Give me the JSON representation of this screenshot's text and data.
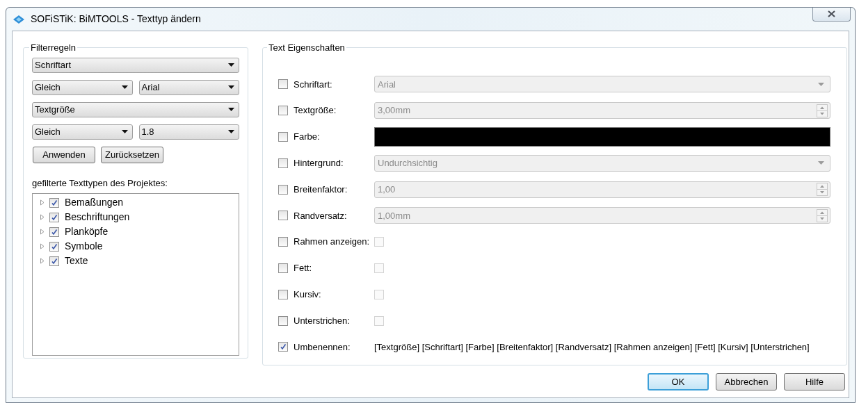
{
  "window": {
    "title": "SOFiSTiK: BiMTOOLS - Texttyp ändern"
  },
  "filter": {
    "title": "Filterregeln",
    "rows": [
      [
        {
          "value": "Schriftart"
        }
      ],
      [
        {
          "value": "Gleich"
        },
        {
          "value": "Arial"
        }
      ],
      [
        {
          "value": "Textgröße"
        }
      ],
      [
        {
          "value": "Gleich"
        },
        {
          "value": "1.8"
        }
      ]
    ],
    "buttons": [
      "Anwenden",
      "Zurücksetzen"
    ],
    "tree_label": "gefilterte Texttypen des Projektes:",
    "tree": [
      {
        "label": "Bemaßungen",
        "checked": true,
        "expanded": false
      },
      {
        "label": "Beschriftungen",
        "checked": true,
        "expanded": false
      },
      {
        "label": "Planköpfe",
        "checked": true,
        "expanded": false
      },
      {
        "label": "Symbole",
        "checked": true,
        "expanded": false
      },
      {
        "label": "Texte",
        "checked": true,
        "expanded": false
      }
    ]
  },
  "properties": {
    "title": "Text Eigenschaften",
    "rows": [
      {
        "kind": "combo",
        "label": "Schriftart:",
        "checked": false,
        "value": "Arial",
        "disabled": true
      },
      {
        "kind": "spin",
        "label": "Textgröße:",
        "checked": false,
        "value": "3,00mm",
        "disabled": true
      },
      {
        "kind": "color",
        "label": "Farbe:",
        "checked": false,
        "color": "#000000"
      },
      {
        "kind": "combo",
        "label": "Hintergrund:",
        "checked": false,
        "value": "Undurchsichtig",
        "disabled": true
      },
      {
        "kind": "spin",
        "label": "Breitenfaktor:",
        "checked": false,
        "value": "1,00",
        "disabled": true
      },
      {
        "kind": "spin",
        "label": "Randversatz:",
        "checked": false,
        "value": "1,00mm",
        "disabled": true
      },
      {
        "kind": "check",
        "label": "Rahmen anzeigen:",
        "checked": false,
        "value_checked": false
      },
      {
        "kind": "check",
        "label": "Fett:",
        "checked": false,
        "value_checked": false
      },
      {
        "kind": "check",
        "label": "Kursiv:",
        "checked": false,
        "value_checked": false
      },
      {
        "kind": "check",
        "label": "Unterstrichen:",
        "checked": false,
        "value_checked": false
      },
      {
        "kind": "text",
        "label": "Umbenennen:",
        "checked": true,
        "value": "[Textgröße] [Schriftart] [Farbe] [Breitenfaktor] [Randversatz] [Rahmen anzeigen] [Fett] [Kursiv] [Unterstrichen]"
      }
    ]
  },
  "buttons": [
    {
      "label": "OK",
      "default": true
    },
    {
      "label": "Abbrechen",
      "default": false
    },
    {
      "label": "Hilfe",
      "default": false
    }
  ]
}
